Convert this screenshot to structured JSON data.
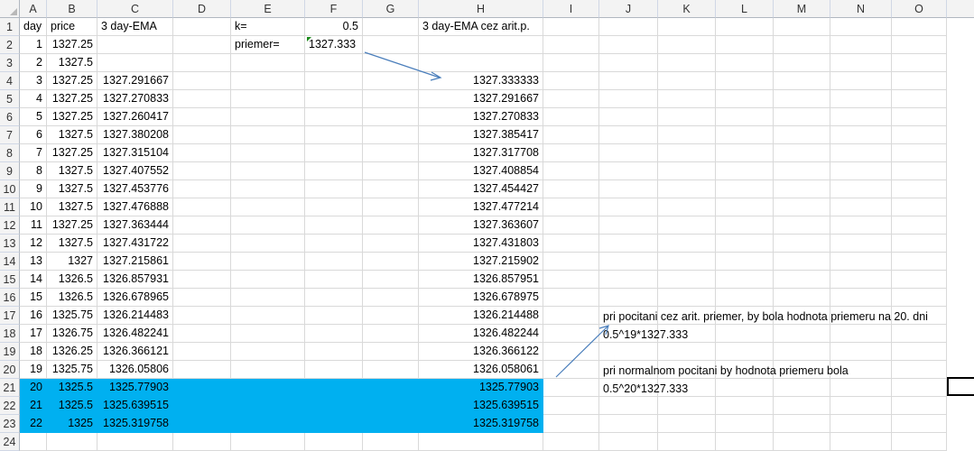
{
  "columns": [
    "A",
    "B",
    "C",
    "D",
    "E",
    "F",
    "G",
    "H",
    "I",
    "J",
    "K",
    "L",
    "M",
    "N",
    "O"
  ],
  "row_numbers": [
    "1",
    "2",
    "3",
    "4",
    "5",
    "6",
    "7",
    "8",
    "9",
    "10",
    "11",
    "12",
    "13",
    "14",
    "15",
    "16",
    "17",
    "18",
    "19",
    "20",
    "21",
    "22",
    "23",
    "24"
  ],
  "headers": {
    "day": "day",
    "price": "price",
    "ema": "3 day-EMA",
    "k_label": "k=",
    "k_value": "0.5",
    "ema_avg": "3 day-EMA cez arit.p."
  },
  "avg": {
    "label": "priemer=",
    "value": "1327.333"
  },
  "rows": [
    {
      "day": "1",
      "price": "1327.25",
      "ema": "",
      "ema_avg": ""
    },
    {
      "day": "2",
      "price": "1327.5",
      "ema": "",
      "ema_avg": ""
    },
    {
      "day": "3",
      "price": "1327.25",
      "ema": "1327.291667",
      "ema_avg": "1327.333333"
    },
    {
      "day": "4",
      "price": "1327.25",
      "ema": "1327.270833",
      "ema_avg": "1327.291667"
    },
    {
      "day": "5",
      "price": "1327.25",
      "ema": "1327.260417",
      "ema_avg": "1327.270833"
    },
    {
      "day": "6",
      "price": "1327.5",
      "ema": "1327.380208",
      "ema_avg": "1327.385417"
    },
    {
      "day": "7",
      "price": "1327.25",
      "ema": "1327.315104",
      "ema_avg": "1327.317708"
    },
    {
      "day": "8",
      "price": "1327.5",
      "ema": "1327.407552",
      "ema_avg": "1327.408854"
    },
    {
      "day": "9",
      "price": "1327.5",
      "ema": "1327.453776",
      "ema_avg": "1327.454427"
    },
    {
      "day": "10",
      "price": "1327.5",
      "ema": "1327.476888",
      "ema_avg": "1327.477214"
    },
    {
      "day": "11",
      "price": "1327.25",
      "ema": "1327.363444",
      "ema_avg": "1327.363607"
    },
    {
      "day": "12",
      "price": "1327.5",
      "ema": "1327.431722",
      "ema_avg": "1327.431803"
    },
    {
      "day": "13",
      "price": "1327",
      "ema": "1327.215861",
      "ema_avg": "1327.215902"
    },
    {
      "day": "14",
      "price": "1326.5",
      "ema": "1326.857931",
      "ema_avg": "1326.857951"
    },
    {
      "day": "15",
      "price": "1326.5",
      "ema": "1326.678965",
      "ema_avg": "1326.678975"
    },
    {
      "day": "16",
      "price": "1325.75",
      "ema": "1326.214483",
      "ema_avg": "1326.214488"
    },
    {
      "day": "17",
      "price": "1326.75",
      "ema": "1326.482241",
      "ema_avg": "1326.482244"
    },
    {
      "day": "18",
      "price": "1326.25",
      "ema": "1326.366121",
      "ema_avg": "1326.366122"
    },
    {
      "day": "19",
      "price": "1325.75",
      "ema": "1326.05806",
      "ema_avg": "1326.058061"
    },
    {
      "day": "20",
      "price": "1325.5",
      "ema": "1325.77903",
      "ema_avg": "1325.77903"
    },
    {
      "day": "21",
      "price": "1325.5",
      "ema": "1325.639515",
      "ema_avg": "1325.639515"
    },
    {
      "day": "22",
      "price": "1325",
      "ema": "1325.319758",
      "ema_avg": "1325.319758"
    }
  ],
  "notes": {
    "line1": "pri pocitani cez arit. priemer, by bola hodnota priemeru na 20. dni",
    "line2": "0.5^19*1327.333",
    "line3": "pri normalnom pocitani by hodnota priemeru bola",
    "line4": "0.5^20*1327.333"
  },
  "colors": {
    "highlight": "#00b0f0",
    "arrow": "#4a7ebb",
    "header_bg": "#f3f3f3",
    "selected_header": "#ffd58e"
  }
}
